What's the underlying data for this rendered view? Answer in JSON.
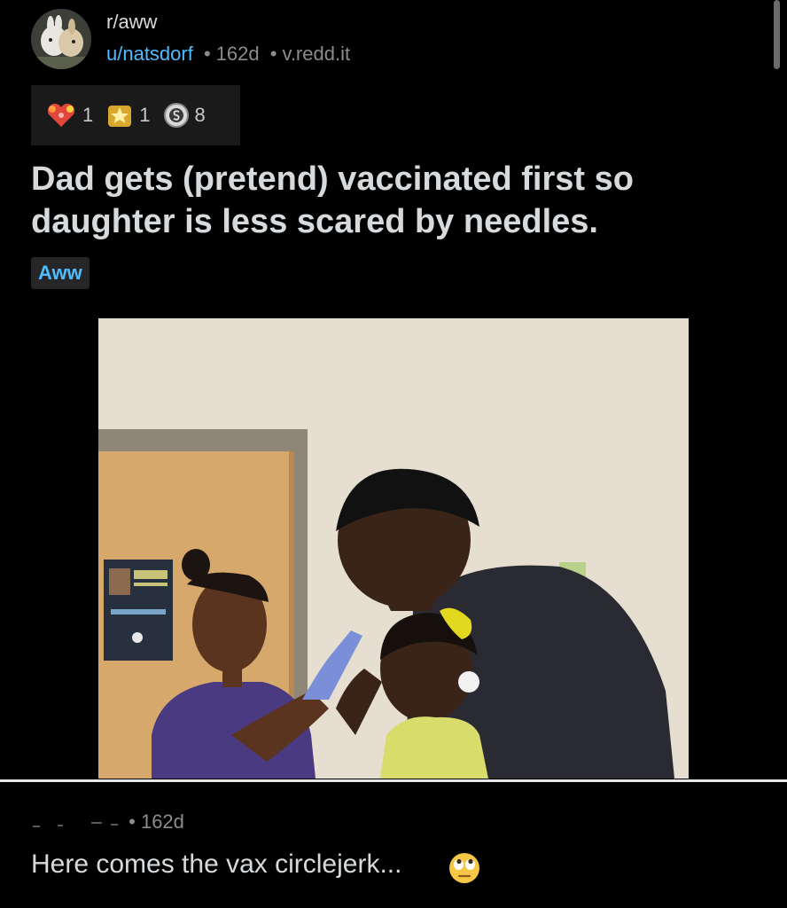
{
  "post": {
    "subreddit": "r/aww",
    "author": "u/natsdorf",
    "age": "162d",
    "domain": "v.redd.it",
    "separator": "•",
    "title": "Dad gets (pretend) vaccinated first so daughter is less scared by needles.",
    "flair": "Aww"
  },
  "awards": [
    {
      "icon": "heart-award-icon",
      "count": "1"
    },
    {
      "icon": "star-award-icon",
      "count": "1"
    },
    {
      "icon": "coin-award-icon",
      "count": "8"
    }
  ],
  "comment": {
    "age": "162d",
    "text": "Here comes the vax circlejerk...",
    "emoji": "face-with-rolling-eyes-icon"
  },
  "colors": {
    "background": "#000000",
    "link": "#4fbcff",
    "meta": "#8a8c8e",
    "text": "#d7dadc"
  }
}
